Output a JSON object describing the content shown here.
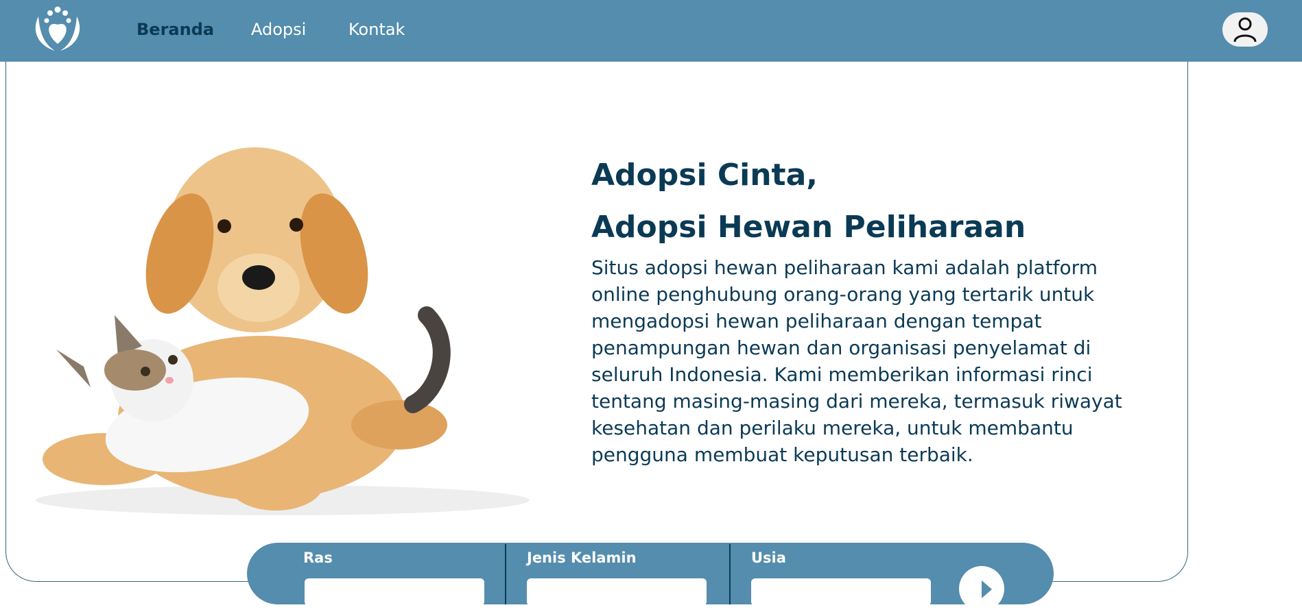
{
  "nav": {
    "items": [
      {
        "label": "Beranda",
        "active": true
      },
      {
        "label": "Adopsi",
        "active": false
      },
      {
        "label": "Kontak",
        "active": false
      }
    ],
    "logo_icon": "paw-heart-logo-icon",
    "profile_icon": "user-icon"
  },
  "hero": {
    "title_line1": "Adopsi Cinta,",
    "title_line2": "Adopsi Hewan Peliharaan",
    "description": "Situs adopsi hewan peliharaan kami adalah platform online penghubung orang-orang yang tertarik untuk mengadopsi hewan peliharaan dengan tempat penampungan hewan dan organisasi penyelamat di seluruh Indonesia. Kami memberikan informasi rinci tentang masing-masing dari mereka, termasuk riwayat kesehatan dan perilaku mereka, untuk membantu pengguna membuat keputusan terbaik."
  },
  "filter": {
    "fields": [
      {
        "label": "Ras",
        "value": ""
      },
      {
        "label": "Jenis Kelamin",
        "value": ""
      },
      {
        "label": "Usia",
        "value": ""
      }
    ],
    "search_icon": "arrow-search-icon"
  },
  "colors": {
    "primary": "#548dad",
    "dark_text": "#0b3a55",
    "background": "#ffffff"
  }
}
